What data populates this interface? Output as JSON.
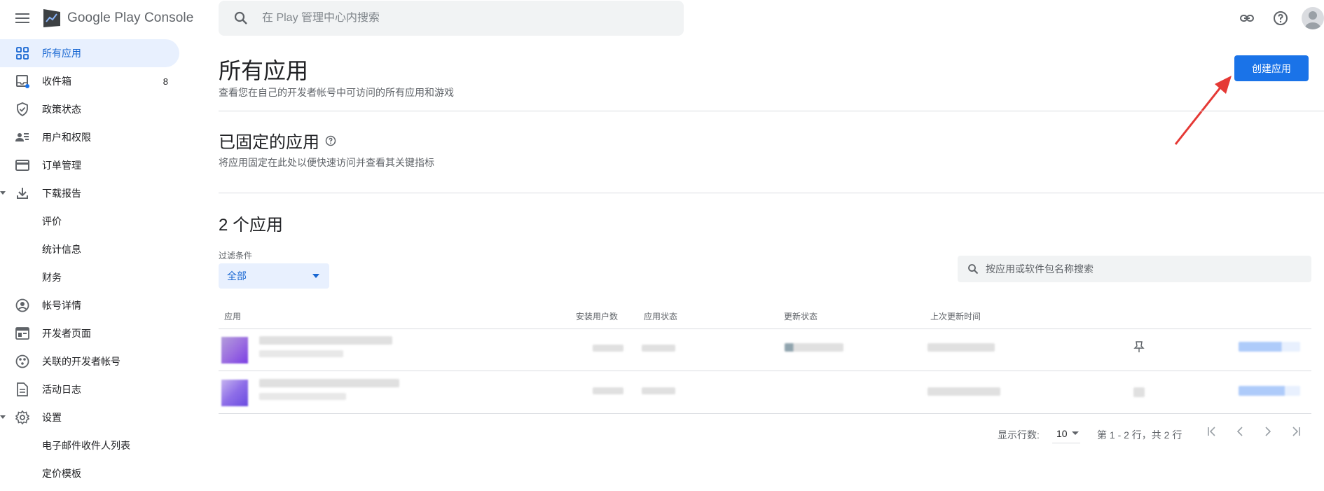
{
  "header": {
    "logo_text": "Google Play Console",
    "search_placeholder": "在 Play 管理中心内搜索",
    "icons": [
      "link-icon",
      "help-icon",
      "account-avatar"
    ]
  },
  "sidebar": {
    "items": [
      {
        "label": "所有应用",
        "icon": "apps-grid-icon",
        "active": true
      },
      {
        "label": "收件箱",
        "icon": "inbox-icon",
        "count": "8"
      },
      {
        "label": "政策状态",
        "icon": "shield-icon"
      },
      {
        "label": "用户和权限",
        "icon": "people-icon"
      },
      {
        "label": "订单管理",
        "icon": "credit-card-icon"
      },
      {
        "label": "下载报告",
        "icon": "download-icon",
        "expanded": true
      },
      {
        "label": "评价"
      },
      {
        "label": "统计信息"
      },
      {
        "label": "财务"
      },
      {
        "label": "帐号详情",
        "icon": "account-circle-icon"
      },
      {
        "label": "开发者页面",
        "icon": "web-page-icon"
      },
      {
        "label": "关联的开发者帐号",
        "icon": "linked-accounts-icon"
      },
      {
        "label": "活动日志",
        "icon": "document-icon"
      },
      {
        "label": "设置",
        "icon": "gear-icon",
        "expanded": true
      },
      {
        "label": "电子邮件收件人列表"
      },
      {
        "label": "定价模板"
      }
    ]
  },
  "main": {
    "title": "所有应用",
    "subtitle": "查看您在自己的开发者帐号中可访问的所有应用和游戏",
    "create_button": "创建应用",
    "pinned_title": "已固定的应用",
    "pinned_subtitle": "将应用固定在此处以便快速访问并查看其关键指标",
    "apps_count": "2 个应用",
    "filter_label": "过滤条件",
    "filter_value": "全部",
    "table_search_placeholder": "按应用或软件包名称搜索",
    "columns": [
      "应用",
      "安装用户数",
      "应用状态",
      "更新状态",
      "上次更新时间"
    ],
    "rows": 2,
    "pagination": {
      "rows_label": "显示行数:",
      "rows_value": "10",
      "range": "第 1 - 2 行，共 2 行"
    }
  },
  "colors": {
    "accent": "#1a73e8",
    "active_bg": "#e8f0fe",
    "annotation_arrow": "#e53935"
  }
}
